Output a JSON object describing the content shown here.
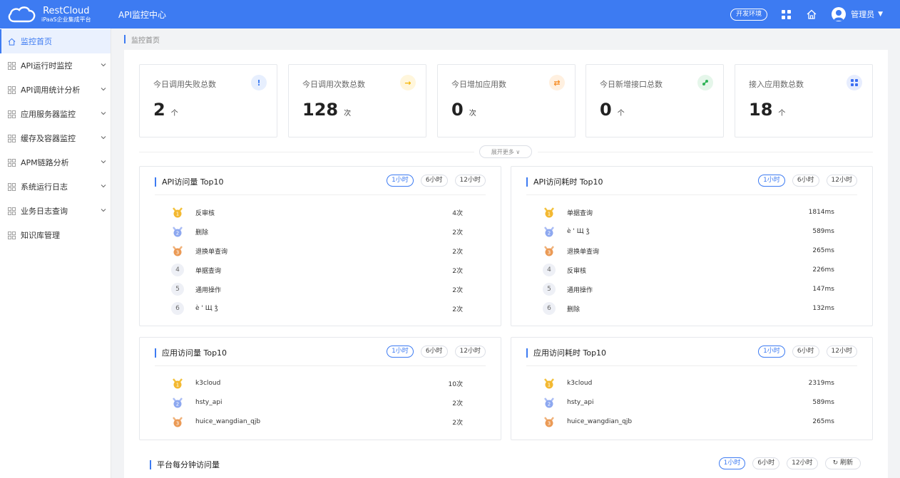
{
  "header": {
    "logo_title": "RestCloud",
    "logo_sub": "iPaaS企业集成平台",
    "app_title": "API监控中心",
    "env_label": "开发环境",
    "user_name": "管理员"
  },
  "breadcrumb": "监控首页",
  "sidebar": {
    "items": [
      {
        "label": "监控首页"
      },
      {
        "label": "API运行时监控"
      },
      {
        "label": "API调用统计分析"
      },
      {
        "label": "应用服务器监控"
      },
      {
        "label": "缓存及容器监控"
      },
      {
        "label": "APM链路分析"
      },
      {
        "label": "系统运行日志"
      },
      {
        "label": "业务日志查询"
      },
      {
        "label": "知识库管理"
      }
    ]
  },
  "stats": [
    {
      "label": "今日调用失败总数",
      "value": "2",
      "unit": "个",
      "icon": "exclamation-icon",
      "color": "#3d7bf2",
      "bg": "#e7effe"
    },
    {
      "label": "今日调用次数总数",
      "value": "128",
      "unit": "次",
      "icon": "arrow-right-icon",
      "color": "#f5b400",
      "bg": "#fff6dc"
    },
    {
      "label": "今日增加应用数",
      "value": "0",
      "unit": "次",
      "icon": "swap-icon",
      "color": "#f58a1f",
      "bg": "#fff0e0"
    },
    {
      "label": "今日新增接口总数",
      "value": "0",
      "unit": "个",
      "icon": "link-icon",
      "color": "#2eb457",
      "bg": "#e5f6ea"
    },
    {
      "label": "接入应用数总数",
      "value": "18",
      "unit": "个",
      "icon": "apps-icon",
      "color": "#3d6ff2",
      "bg": "#e7edfe"
    }
  ],
  "expand_label": "展开更多",
  "ranges": [
    "1小时",
    "6小时",
    "12小时"
  ],
  "panels": {
    "api_visits": {
      "title": "API访问量 Top10",
      "rows": [
        {
          "rank": "1",
          "name": "反审核",
          "value": "4次"
        },
        {
          "rank": "2",
          "name": "删除",
          "value": "2次"
        },
        {
          "rank": "3",
          "name": "退换单查询",
          "value": "2次"
        },
        {
          "rank": "4",
          "name": "单据查询",
          "value": "2次"
        },
        {
          "rank": "5",
          "name": "通用操作",
          "value": "2次"
        },
        {
          "rank": "6",
          "name": "è ' Щ ǯ",
          "value": "2次"
        }
      ]
    },
    "api_time": {
      "title": "API访问耗时 Top10",
      "rows": [
        {
          "rank": "1",
          "name": "单据查询",
          "value": "1814ms"
        },
        {
          "rank": "2",
          "name": "è ' Щ ǯ",
          "value": "589ms"
        },
        {
          "rank": "3",
          "name": "退换单查询",
          "value": "265ms"
        },
        {
          "rank": "4",
          "name": "反审核",
          "value": "226ms"
        },
        {
          "rank": "5",
          "name": "通用操作",
          "value": "147ms"
        },
        {
          "rank": "6",
          "name": "删除",
          "value": "132ms"
        }
      ]
    },
    "app_visits": {
      "title": "应用访问量 Top10",
      "rows": [
        {
          "rank": "1",
          "name": "k3cloud",
          "value": "10次"
        },
        {
          "rank": "2",
          "name": "hsty_api",
          "value": "2次"
        },
        {
          "rank": "3",
          "name": "huice_wangdian_qjb",
          "value": "2次"
        }
      ]
    },
    "app_time": {
      "title": "应用访问耗时 Top10",
      "rows": [
        {
          "rank": "1",
          "name": "k3cloud",
          "value": "2319ms"
        },
        {
          "rank": "2",
          "name": "hsty_api",
          "value": "589ms"
        },
        {
          "rank": "3",
          "name": "huice_wangdian_qjb",
          "value": "265ms"
        }
      ]
    }
  },
  "bottom": {
    "title": "平台每分钟访问量",
    "refresh_label": "刷新"
  }
}
